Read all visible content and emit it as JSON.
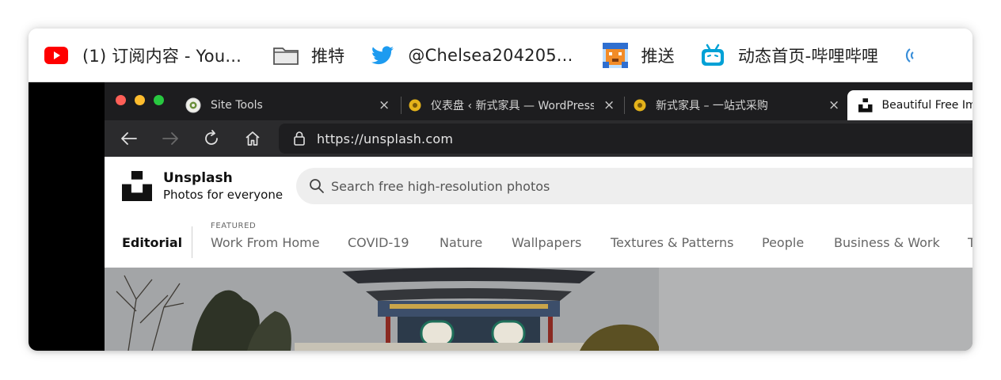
{
  "bookmarks": [
    {
      "label": "(1) 订阅内容 - You...",
      "icon": "youtube-icon"
    },
    {
      "label": "推特",
      "icon": "folder-icon"
    },
    {
      "label": "@Chelsea204205...",
      "icon": "twitter-icon"
    },
    {
      "label": "推送",
      "icon": "pixel-avatar-icon"
    },
    {
      "label": "动态首页-哔哩哔哩",
      "icon": "bilibili-icon"
    }
  ],
  "tabs": [
    {
      "label": "Site Tools",
      "close": "×"
    },
    {
      "label": "仪表盘 ‹ 新式家具 — WordPress",
      "close": "×"
    },
    {
      "label": "新式家具 – 一站式采购",
      "close": "×"
    },
    {
      "label": "Beautiful Free Images",
      "active": true
    }
  ],
  "address_bar": {
    "url": "https://unsplash.com"
  },
  "unsplash": {
    "name": "Unsplash",
    "tagline": "Photos for everyone",
    "search_placeholder": "Search free high-resolution photos",
    "featured_label": "FEATURED",
    "nav": [
      "Editorial",
      "Work From Home",
      "COVID-19",
      "Nature",
      "Wallpapers",
      "Textures & Patterns",
      "People",
      "Business & Work",
      "T"
    ]
  },
  "colors": {
    "youtube_red": "#ff0000",
    "twitter_blue": "#1d9bf0",
    "bilibili_blue": "#00a1d6",
    "close_red": "#ff5f57",
    "minimize_yellow": "#febc2e",
    "maximize_green": "#28c840"
  }
}
